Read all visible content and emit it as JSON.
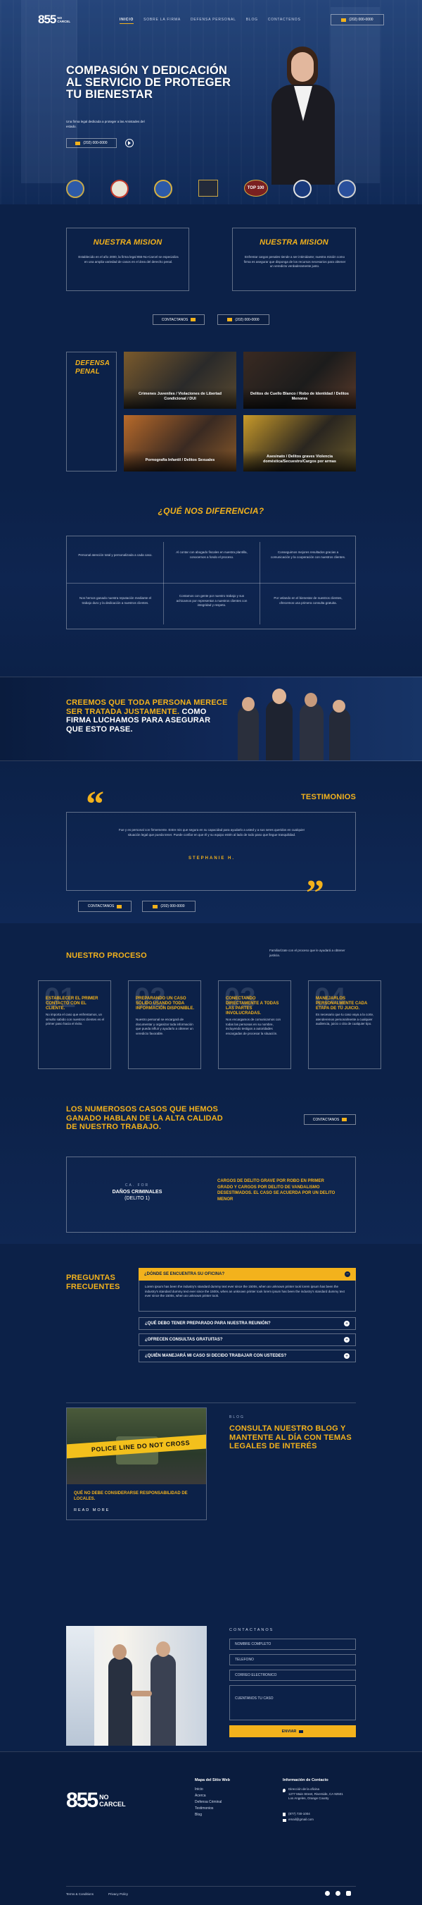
{
  "brand": {
    "logo_num": "855",
    "logo_sub_1": "NO",
    "logo_sub_2": "CARCEL"
  },
  "nav": {
    "items": [
      "INICIO",
      "SOBRE LA FIRMA",
      "DEFENSA PERSONAL",
      "BLOG",
      "CONTACTENOS"
    ],
    "phone": "(202) 000-0000"
  },
  "hero": {
    "title_1": "COMPASIÓN Y DEDICACIÓN",
    "title_2": "AL SERVICIO DE PROTEGER",
    "title_3": "TU BIENESTAR",
    "text": "Una firma legal dedicada a proteger a las Amistades del estado.",
    "phone_button": "(202) 000-0000",
    "badges": [
      "badge-1",
      "badge-2",
      "badge-3",
      "badge-4",
      "TOP 100",
      "badge-6",
      "badge-7"
    ]
  },
  "mission": {
    "left_title": "NUESTRA MISION",
    "left_text": "Establecido en el año 2000, la firma legal 855-No-Carcel se especializa en una amplia variedad de casos en el área del derecho penal.",
    "right_title": "NUESTRA MISION",
    "right_text": "Enfrentar cargos penales tiende a ser intimidante; nuestra misión como firma es asegurar que disponga de los recursos necesarios para obtener un veredicto verdaderamente justo.",
    "contact_button": "CONTACTANOS",
    "phone_button": "(202) 000-0000"
  },
  "defense": {
    "label_1": "DEFENSA",
    "label_2": "PENAL",
    "tiles": [
      "Crimenes Juveniles / Violaciones de Libertad Condicional / DUI",
      "Delitos de Cuello Blanco / Robo de Identidad / Delitos Menores",
      "Pornografía Infantil / Delitos Sexuales",
      "Asesinato / Delitos graves Violencia doméstica/Secuestro/Cargos por armas"
    ]
  },
  "difference": {
    "title": "¿QUÉ NOS DIFERENCIA?",
    "items": [
      "Personal atención total y personalizada a cada caso.",
      "Al contar con abogado fiscales en nuestra plantilla, conocemos a fondo el proceso.",
      "Conseguimos mejores resultados gracias a comunicación y la cooperación con nuestros clientes.",
      "Nos hemos ganado nuestra reputación mediante el trabajo duro y la dedicación a nuestros clientes.",
      "Contamos con gente por nuestro trabajo y sus achicamos por representar a nuestros clientes con integridad y respeto.",
      "Por velando en el bienestar de nuestros clientes, ofrecemos una primera consulta gratuita."
    ]
  },
  "banner": {
    "line_1_gold": "CREEMOS QUE TODA PERSONA MERECE",
    "line_2_gold": "SER TRATADA JUSTAMENTE.",
    "line_2_white": " COMO",
    "line_3": "FIRMA LUCHAMOS PARA ASEGURAR",
    "line_4": "QUE ESTO PASE."
  },
  "testimonials": {
    "title": "TESTIMONIOS",
    "text": "Fue y es personal con firmemente. Entre mis que segura en su capacidad para ayudarlo a usted y a sus seres queridos en cualquier situación legal que pueda tener. Puede confiar en que él y su equipo estén al lado de todo paso que llegue tranquilidad.",
    "author": "STEPHANIE H.",
    "contact_button": "CONTACTANOS",
    "phone_button": "(202) 000-0000"
  },
  "process": {
    "title": "NUESTRO PROCESO",
    "intro": "Familiarízate con el proceso que le ayudará a obtener justicia.",
    "steps": [
      {
        "num": "01",
        "title": "ESTABLECER EL PRIMER CONTACTO CON EL CLIENTE.",
        "text": "No importa el caso que enfrentamos, un simulto sabido con nuestros clientes es el primer paso hacia el éxito."
      },
      {
        "num": "02",
        "title": "PREPARANDO UN CASO SÓLIDO USANDO TODA INFORMACIÓN DISPONIBLE.",
        "text": "Nuestro personal se encargará de documentar y organizar toda información que pueda influir y ayudarlo a obtener un veredicto favorable."
      },
      {
        "num": "03",
        "title": "CONECTANDO DIRECTAMENTE A TODAS LAS PARTES INVOLUCRADAS.",
        "text": "Nos encargamos de comunicarnos con todas las personas en su nombre, incluyendo testigos a autoridades encargadas de procesar la situación."
      },
      {
        "num": "04",
        "title": "MANEJARLOS PERSONALMENTE CADA ETAPA DE TU JUICIO.",
        "text": "Es necesario que tu caso vaya a la corte, atenderemos personalmente a cualquier audiencia, juicio o cita de cualquier tipo."
      }
    ]
  },
  "cases": {
    "title_1": "LOS NUMEROSOS CASOS QUE HEMOS",
    "title_2": "GANADO HABLAN DE LA ALTA CALIDAD",
    "title_3": "DE NUESTRO TRABAJO.",
    "contact_button": "CONTACTANOS",
    "kicker": "CA. FOR",
    "case_name": "DAÑOS CRIMINALES",
    "case_sub": "(DELITO 1)",
    "result": "CARGOS DE DELITO GRAVE POR ROBO EN PRIMER GRADO Y CARGOS POR DELITO DE VANDALISMO DESESTIMADOS. EL CASO SE ACUERDA POR UN DELITO MENOR"
  },
  "faq": {
    "title_1": "PREGUNTAS",
    "title_2": "FRECUENTES",
    "open_question": "¿DÓNDE SE ENCUENTRA SU OFICINA?",
    "open_answer": "Lorem ipsum has been the industry's standard dummy text ever since the 1500s, when an unknown printer took lorem ipsum has been the industry's standard dummy text ever since the 1500s, when an unknown printer took lorem ipsum has been the industry's standard dummy text ever since the 1500s, when an unknown printer took.",
    "questions": [
      "¿QUÉ DEBO TENER PREPARADO PARA NUESTRA REUNIÓN?",
      "¿OFRECEN CONSULTAS GRATUITAS?",
      "¿QUIÉN MANEJARÁ MI CASO SI DECIDO TRABAJAR CON USTEDES?"
    ]
  },
  "blog": {
    "kicker": "BLOG",
    "title_1": "CONSULTA NUESTRO BLOG Y",
    "title_2": "MANTENTE AL DÍA CON TEMAS",
    "title_3": "LEGALES DE INTERÉS",
    "tape_text": "POLICE LINE DO NOT CROSS",
    "post_title": "QUÉ NO DEBE CONSIDERARSE RESPONSABILIDAD DE LOCALES.",
    "read_more": "READ MORE"
  },
  "contact": {
    "title": "CONTACTANOS",
    "fields": [
      "NOMBRE COMPLETO",
      "TELEFONO",
      "CORREO ELECTRONICO",
      "CUENTANOS TU CASO"
    ],
    "submit": "ENVIAR"
  },
  "footer": {
    "map_title": "Mapa del Sitio Web",
    "map_links": [
      "Inicio",
      "Acerca",
      "Defensa Criminal",
      "Testimonios",
      "Blog"
    ],
    "info_title": "Información de Contacto",
    "address_label": "Dirección de la oficina",
    "address": "1277 Main Street, Riverside, CA 92501 Los Angeles, Orange County",
    "phone": "(877) 730-1004",
    "email": "email@gmail.com",
    "terms": "Terms & Conditions",
    "privacy": "Privacy Policy"
  },
  "colors": {
    "navy": "#0c2148",
    "gold": "#f3b21c",
    "dark_navy": "#0a1c3e"
  }
}
